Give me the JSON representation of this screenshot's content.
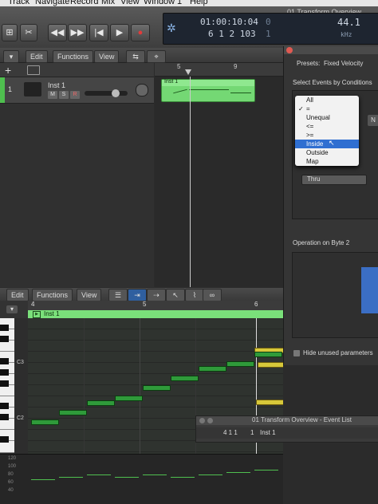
{
  "menubar": {
    "items": [
      "Track",
      "Navigate",
      "Record",
      "Mix",
      "View",
      "Window",
      "1",
      "Help"
    ]
  },
  "transport": {
    "window_title": "01 Transform Overview",
    "time": "01:00:10:04",
    "time_suffix": "0",
    "position": "6  1  2  103",
    "position_suffix": "1",
    "tempo_top": "44.1",
    "tempo_bottom": "kHz"
  },
  "tracks": {
    "menus": [
      "Edit",
      "Functions",
      "View"
    ],
    "track_number": "1",
    "track_name": "Inst 1",
    "mute": "M",
    "solo": "S",
    "record": "R",
    "region_name": "Inst 1",
    "ruler_bars": [
      "5",
      "9"
    ]
  },
  "transform": {
    "presets_label": "Presets:",
    "presets_value": "Fixed Velocity",
    "section_title": "Select Events by Conditions",
    "options": [
      "All",
      "=",
      "Unequal",
      "<=",
      ">=",
      "Inside",
      "Outside",
      "Map"
    ],
    "checked_option": "=",
    "selected_option": "Inside",
    "side_value": "N",
    "thru_value": "Thru",
    "operation_label": "Operation on Byte 2",
    "hide_unused": "Hide unused parameters"
  },
  "piano_roll": {
    "menus": [
      "Edit",
      "Functions",
      "View"
    ],
    "ruler_bars": [
      "4",
      "5",
      "6"
    ],
    "region_name": "Inst 1",
    "key_labels": [
      "C3",
      "C2"
    ],
    "velocity_ticks": [
      "120",
      "100",
      "80",
      "60",
      "40"
    ]
  },
  "event_list": {
    "title": "01 Transform Overview - Event List",
    "row_position": "4  1  1",
    "row_length": "1",
    "row_name": "Inst 1"
  },
  "notes": [
    {
      "bar": 4.0,
      "pitch": 0,
      "vel": 0.5
    },
    {
      "bar": 4.25,
      "pitch": 2,
      "vel": 0.55
    },
    {
      "bar": 4.5,
      "pitch": 4,
      "vel": 0.6
    },
    {
      "bar": 4.75,
      "pitch": 5,
      "vel": 0.55
    },
    {
      "bar": 5.0,
      "pitch": 7,
      "vel": 0.6
    },
    {
      "bar": 5.25,
      "pitch": 9,
      "vel": 0.55
    },
    {
      "bar": 5.5,
      "pitch": 11,
      "vel": 0.6
    },
    {
      "bar": 5.75,
      "pitch": 12,
      "vel": 0.65
    },
    {
      "bar": 6.0,
      "pitch": 14,
      "vel": 0.7
    }
  ],
  "colors": {
    "region": "#7ae07a",
    "note": "#2f9a3a",
    "note_yellow": "#d7c83a",
    "accent_select": "#2f6fd1"
  }
}
